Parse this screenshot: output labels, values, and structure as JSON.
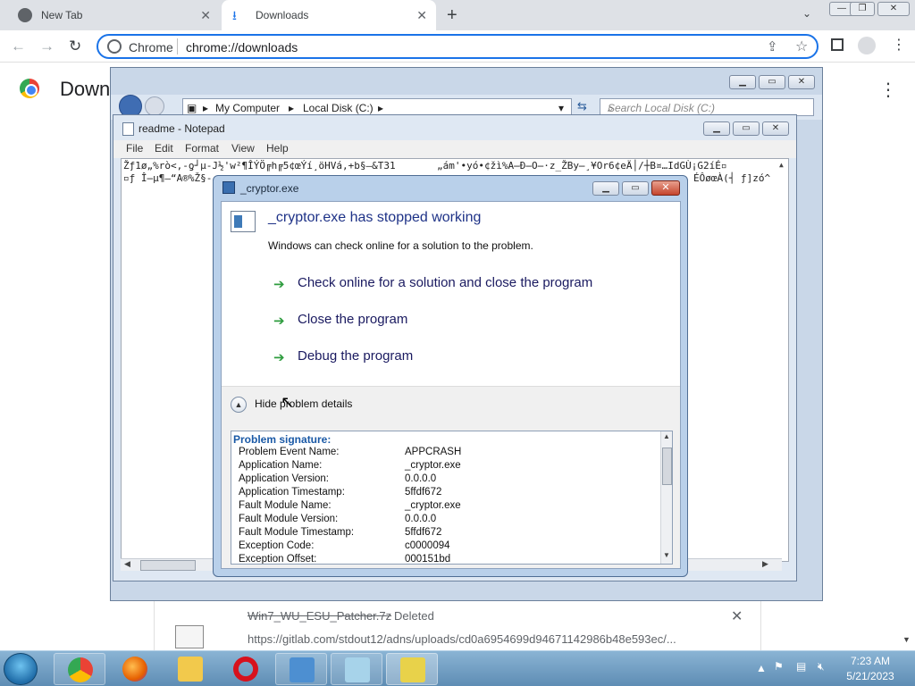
{
  "chrome": {
    "tabs": [
      {
        "label": "New Tab"
      },
      {
        "label": "Downloads"
      }
    ],
    "omnibox_site": "Chrome",
    "omnibox_url": "chrome://downloads",
    "page_title": "Down",
    "download": {
      "filename": "Win7_WU_ESU_Patcher.7z",
      "status": "Deleted",
      "url": "https://gitlab.com/stdout12/adns/uploads/cd0a6954699d94671142986b48e593ec/..."
    }
  },
  "explorer": {
    "breadcrumb": [
      "My Computer",
      "Local Disk (C:)"
    ],
    "search_placeholder": "Search Local Disk (C:)"
  },
  "notepad": {
    "title": "readme - Notepad",
    "menu": [
      "File",
      "Edit",
      "Format",
      "View",
      "Help"
    ],
    "line1": "Žƒ1ø„%rò<,-ƍ┘µ-Ј½'w²¶ÎÝÖ╔h╔5¢œÝí¸öHVá,+b§–&T31       „ám'•yó•¢žì%A̶Ð̶O̶·z_ŽBy̶¸¥Or6¢eÄ│/┼B¤…IdGÙ¡G2íÉ▫",
    "line2": "▫ƒ Î̶µ¶–“A®%Ž§-",
    "line2b": "ÉÔøœÀ(┤ ƒ]zó^"
  },
  "crash_dialog": {
    "window_title": "_cryptor.exe",
    "heading": "_cryptor.exe has stopped working",
    "subtitle": "Windows can check online for a solution to the problem.",
    "options": [
      "Check online for a solution and close the program",
      "Close the program",
      "Debug the program"
    ],
    "details_toggle": "Hide problem details",
    "details_heading": "Problem signature:",
    "details": [
      {
        "key": "Problem Event Name:",
        "value": "APPCRASH"
      },
      {
        "key": "Application Name:",
        "value": "_cryptor.exe"
      },
      {
        "key": "Application Version:",
        "value": "0.0.0.0"
      },
      {
        "key": "Application Timestamp:",
        "value": "5ffdf672"
      },
      {
        "key": "Fault Module Name:",
        "value": "_cryptor.exe"
      },
      {
        "key": "Fault Module Version:",
        "value": "0.0.0.0"
      },
      {
        "key": "Fault Module Timestamp:",
        "value": "5ffdf672"
      },
      {
        "key": "Exception Code:",
        "value": "c0000094"
      },
      {
        "key": "Exception Offset:",
        "value": "000151bd"
      }
    ]
  },
  "taskbar": {
    "time": "7:23 AM",
    "date": "5/21/2023"
  },
  "colors": {
    "chrome_accent": "#1a73e8",
    "heading_blue": "#1e3287",
    "taskbar": "#6f9cc3"
  }
}
